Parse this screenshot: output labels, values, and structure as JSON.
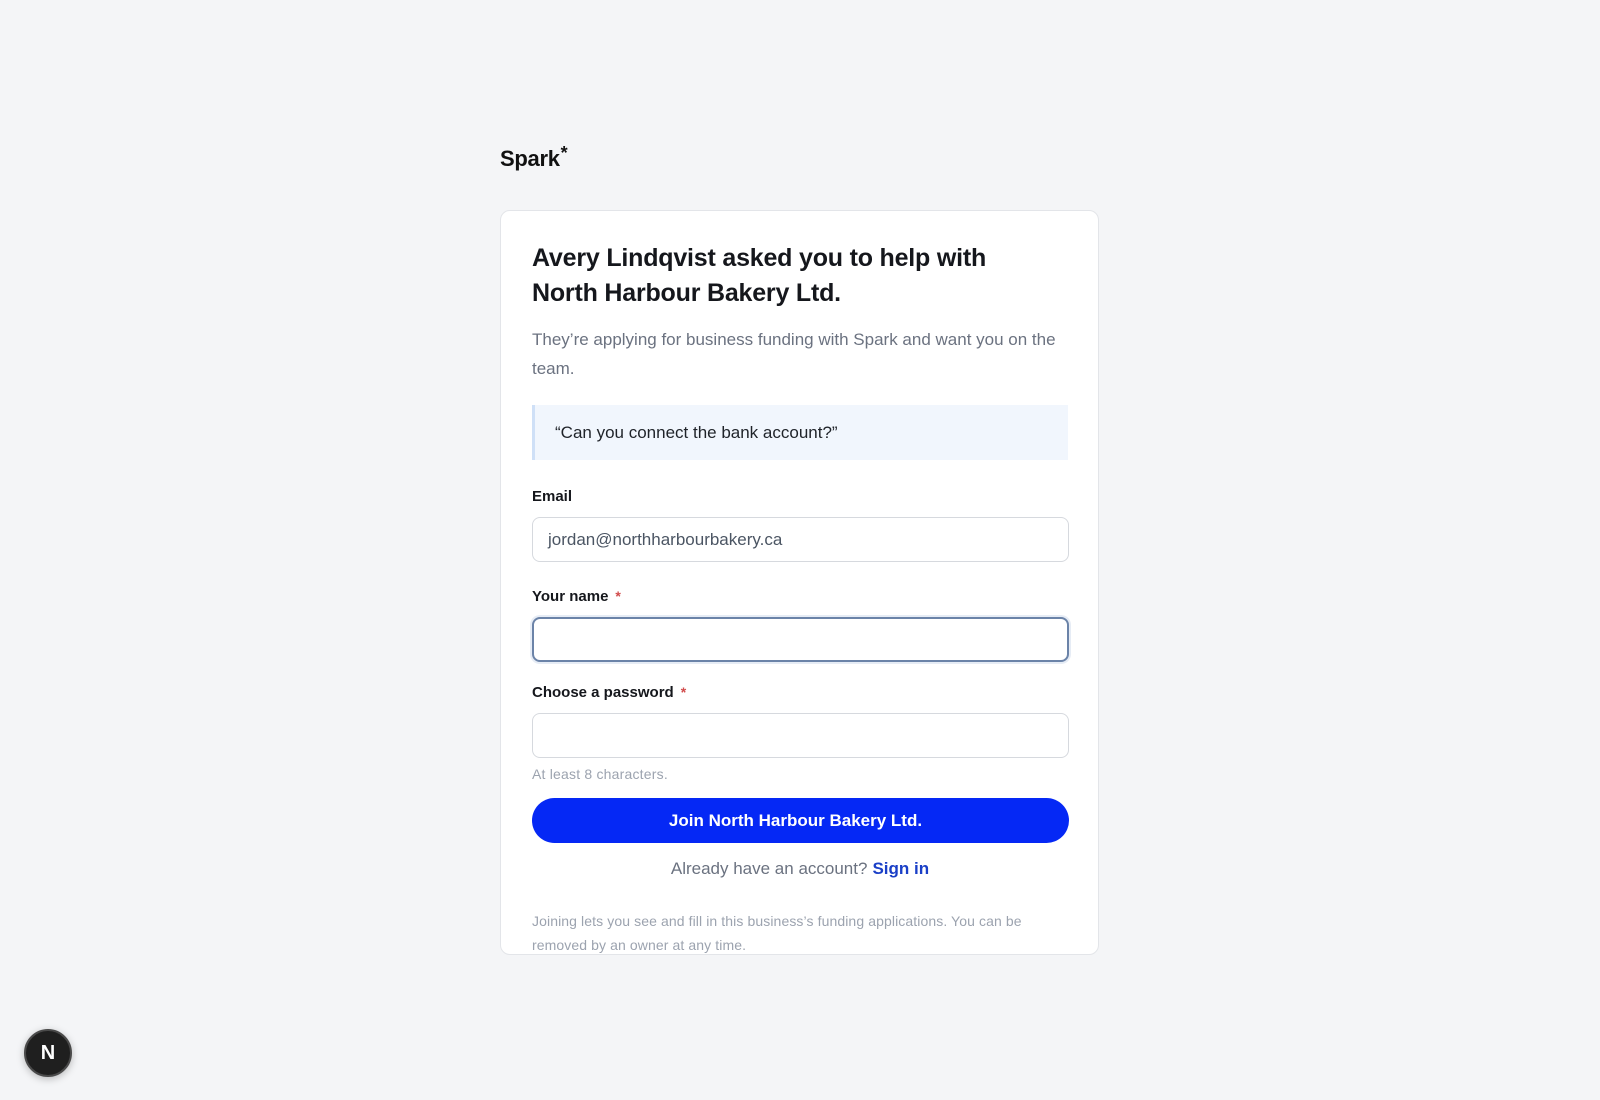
{
  "brand": {
    "name": "Spark",
    "mark": "*"
  },
  "invite": {
    "headline": "Avery Lindqvist asked you to help with North Harbour Bakery Ltd.",
    "subtext": "They’re applying for business funding with Spark and want you on the team.",
    "quote": "“Can you connect the bank account?”"
  },
  "form": {
    "email": {
      "label": "Email",
      "value": "jordan@northharbourbakery.ca"
    },
    "name": {
      "label": "Your name",
      "required_mark": "*",
      "value": ""
    },
    "password": {
      "label": "Choose a password",
      "required_mark": "*",
      "value": "",
      "hint": "At least 8 characters."
    },
    "submit_label": "Join North Harbour Bakery Ltd.",
    "signin_prompt": "Already have an account?",
    "signin_link": "Sign in",
    "footnote": "Joining lets you see and fill in this business’s funding applications. You can be removed by an owner at any time."
  },
  "dev_badge": {
    "letter": "N",
    "icon": "nextjs-icon"
  },
  "colors": {
    "accent": "#0528f5",
    "link": "#1a3fc7",
    "background": "#f4f5f7",
    "required": "#d14b4b",
    "quote_bg": "#f1f6fd"
  }
}
